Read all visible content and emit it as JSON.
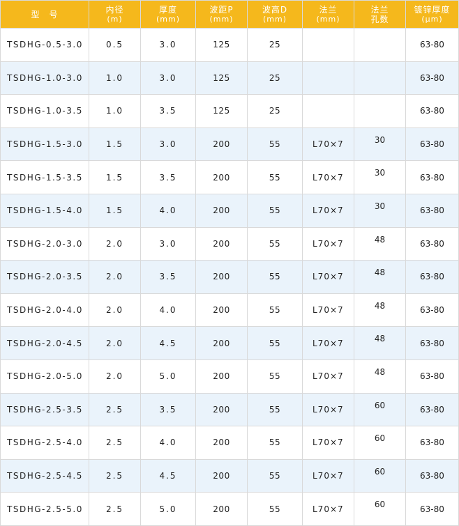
{
  "header": {
    "model": "型　号",
    "inner_dia": "内径",
    "inner_dia_unit": "(m)",
    "thickness": "厚度",
    "thickness_unit": "(mm)",
    "pitch": "波距P",
    "pitch_unit": "(mm)",
    "height": "波高D",
    "height_unit": "(mm)",
    "flange": "法兰",
    "flange_unit": "(mm)",
    "flange_holes_1": "法兰",
    "flange_holes_2": "孔数",
    "zinc": "镀锌厚度",
    "zinc_unit": "(μm)"
  },
  "rows": [
    {
      "model": "TSDHG-0.5-3.0",
      "inner": "0.5",
      "thick": "3.0",
      "pitch": "125",
      "height": "25",
      "flange": "",
      "holes": "",
      "zinc": "63-80"
    },
    {
      "model": "TSDHG-1.0-3.0",
      "inner": "1.0",
      "thick": "3.0",
      "pitch": "125",
      "height": "25",
      "flange": "",
      "holes": "",
      "zinc": "63-80"
    },
    {
      "model": "TSDHG-1.0-3.5",
      "inner": "1.0",
      "thick": "3.5",
      "pitch": "125",
      "height": "25",
      "flange": "",
      "holes": "",
      "zinc": "63-80"
    },
    {
      "model": "TSDHG-1.5-3.0",
      "inner": "1.5",
      "thick": "3.0",
      "pitch": "200",
      "height": "55",
      "flange": "L70×7",
      "holes": "30",
      "zinc": "63-80"
    },
    {
      "model": "TSDHG-1.5-3.5",
      "inner": "1.5",
      "thick": "3.5",
      "pitch": "200",
      "height": "55",
      "flange": "L70×7",
      "holes": "30",
      "zinc": "63-80"
    },
    {
      "model": "TSDHG-1.5-4.0",
      "inner": "1.5",
      "thick": "4.0",
      "pitch": "200",
      "height": "55",
      "flange": "L70×7",
      "holes": "30",
      "zinc": "63-80"
    },
    {
      "model": "TSDHG-2.0-3.0",
      "inner": "2.0",
      "thick": "3.0",
      "pitch": "200",
      "height": "55",
      "flange": "L70×7",
      "holes": "48",
      "zinc": "63-80"
    },
    {
      "model": "TSDHG-2.0-3.5",
      "inner": "2.0",
      "thick": "3.5",
      "pitch": "200",
      "height": "55",
      "flange": "L70×7",
      "holes": "48",
      "zinc": "63-80"
    },
    {
      "model": "TSDHG-2.0-4.0",
      "inner": "2.0",
      "thick": "4.0",
      "pitch": "200",
      "height": "55",
      "flange": "L70×7",
      "holes": "48",
      "zinc": "63-80"
    },
    {
      "model": "TSDHG-2.0-4.5",
      "inner": "2.0",
      "thick": "4.5",
      "pitch": "200",
      "height": "55",
      "flange": "L70×7",
      "holes": "48",
      "zinc": "63-80"
    },
    {
      "model": "TSDHG-2.0-5.0",
      "inner": "2.0",
      "thick": "5.0",
      "pitch": "200",
      "height": "55",
      "flange": "L70×7",
      "holes": "48",
      "zinc": "63-80"
    },
    {
      "model": "TSDHG-2.5-3.5",
      "inner": "2.5",
      "thick": "3.5",
      "pitch": "200",
      "height": "55",
      "flange": "L70×7",
      "holes": "60",
      "zinc": "63-80"
    },
    {
      "model": "TSDHG-2.5-4.0",
      "inner": "2.5",
      "thick": "4.0",
      "pitch": "200",
      "height": "55",
      "flange": "L70×7",
      "holes": "60",
      "zinc": "63-80"
    },
    {
      "model": "TSDHG-2.5-4.5",
      "inner": "2.5",
      "thick": "4.5",
      "pitch": "200",
      "height": "55",
      "flange": "L70×7",
      "holes": "60",
      "zinc": "63-80"
    },
    {
      "model": "TSDHG-2.5-5.0",
      "inner": "2.5",
      "thick": "5.0",
      "pitch": "200",
      "height": "55",
      "flange": "L70×7",
      "holes": "60",
      "zinc": "63-80"
    }
  ],
  "colors": {
    "header_bg": "#f5b81c",
    "header_text": "#ffffff",
    "stripe_bg": "#eaf3fb",
    "border": "#d9d9d9"
  }
}
